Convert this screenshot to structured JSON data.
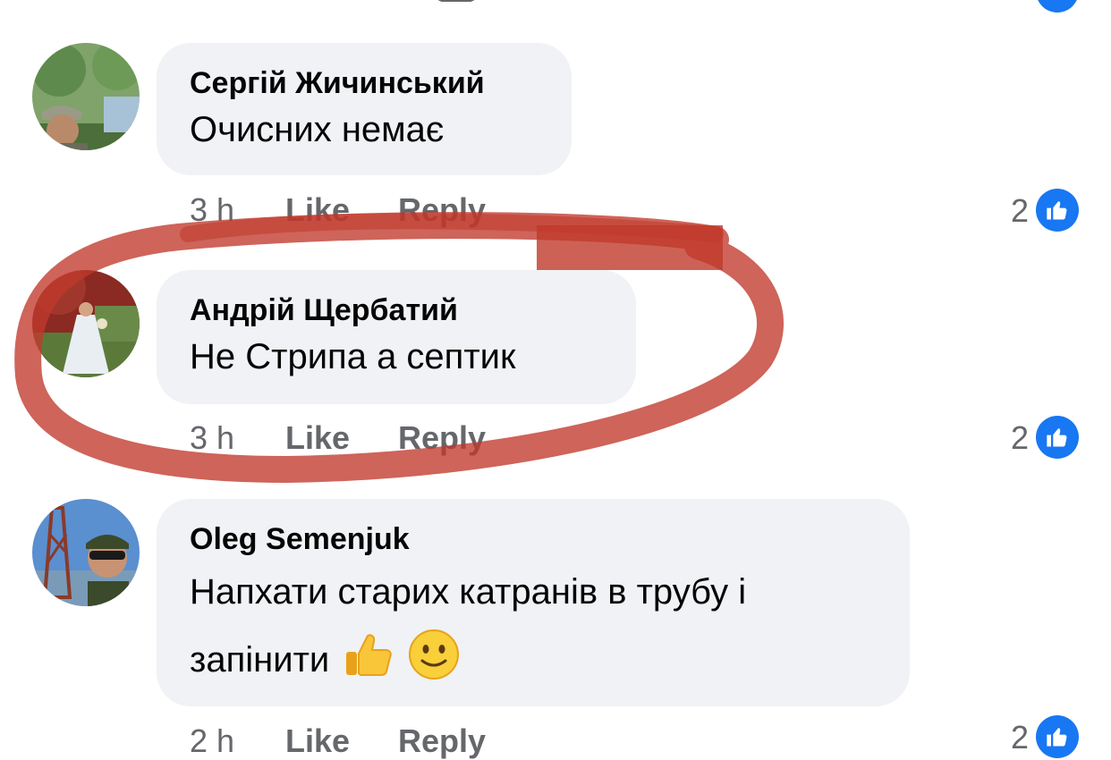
{
  "comments": [
    {
      "author": "Сергій Жичинський",
      "text": "Очисних немає",
      "time": "3 h",
      "like_label": "Like",
      "reply_label": "Reply",
      "reaction_count": "2",
      "reaction_icon": "thumbs-up-icon"
    },
    {
      "author": "Андрій Щербатий",
      "text": "Не Стрипа а  септик",
      "time": "3 h",
      "like_label": "Like",
      "reply_label": "Reply",
      "reaction_count": "2",
      "reaction_icon": "thumbs-up-icon"
    },
    {
      "author": "Oleg  Semenjuk",
      "text_line1": "Напхати старих катранів в трубу і",
      "text_line2": "запінити",
      "emojis": [
        "thumbs-up-emoji",
        "slightly-smiling-face-emoji"
      ],
      "time": "2 h",
      "like_label": "Like",
      "reply_label": "Reply",
      "reaction_count": "2",
      "reaction_icon": "thumbs-up-icon"
    }
  ],
  "annotation": {
    "color": "#c0392b",
    "shape": "hand-drawn-circle"
  },
  "colors": {
    "bubble": "#f0f2f5",
    "meta_text": "#65676b",
    "like_blue": "#1877f2"
  }
}
